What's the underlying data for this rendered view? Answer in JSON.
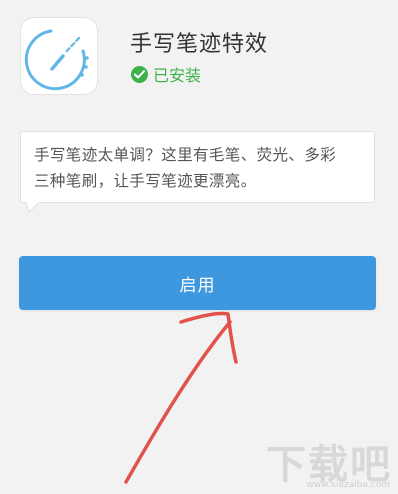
{
  "app": {
    "title": "手写笔迹特效",
    "status": "已安装",
    "description_line1": "手写笔迹太单调？这里有毛笔、荧光、多彩",
    "description_line2": "三种笔刷，让手写笔迹更漂亮。",
    "button_label": "启用"
  },
  "icons": {
    "app_icon": "pen-stroke-icon",
    "status_icon": "check-circle-icon"
  },
  "colors": {
    "status_green": "#3cb34a",
    "button_blue": "#3d98e0",
    "icon_stroke": "#62b6e6",
    "annotation_red": "#e0524a"
  },
  "watermark": {
    "main": "下载吧",
    "sub": "www.xiazaiba.com"
  }
}
